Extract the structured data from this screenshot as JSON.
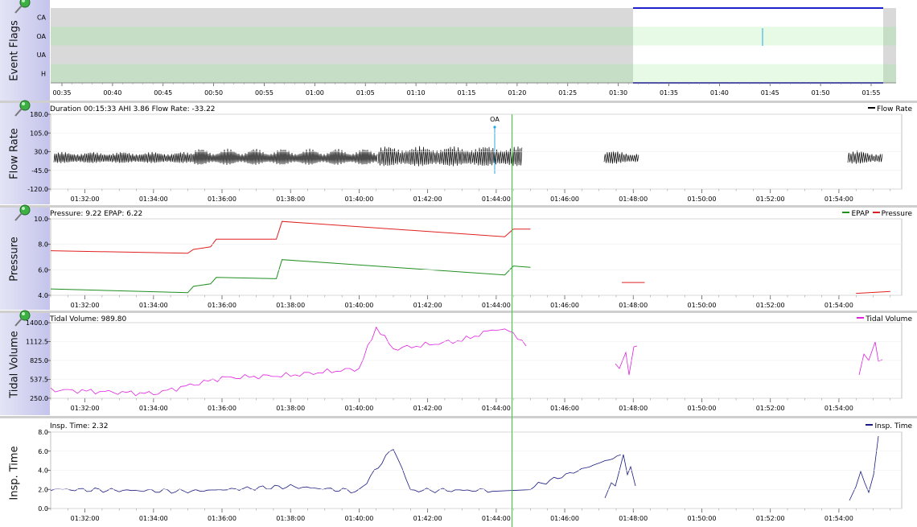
{
  "event_flags": {
    "label": "Event Flags",
    "rows": [
      "CA",
      "OA",
      "UA",
      "H"
    ],
    "xticks": [
      "00:35",
      "00:40",
      "00:45",
      "00:50",
      "00:55",
      "01:00",
      "01:05",
      "01:10",
      "01:15",
      "01:20",
      "01:25",
      "01:30",
      "01:35",
      "01:40",
      "01:45",
      "01:50",
      "01:55"
    ],
    "events": [
      {
        "type": "OA",
        "time": "01:44"
      }
    ],
    "selected_range": [
      "01:31",
      "01:56"
    ]
  },
  "xticks": [
    "01:32:00",
    "01:34:00",
    "01:36:00",
    "01:38:00",
    "01:40:00",
    "01:42:00",
    "01:44:00",
    "01:46:00",
    "01:48:00",
    "01:50:00",
    "01:52:00",
    "01:54:00"
  ],
  "flow_rate": {
    "label": "Flow Rate",
    "info": "Duration 00:15:33 AHI 3.86 Flow Rate: -33.22",
    "legend": "Flow Rate",
    "event_label": "OA",
    "yticks": [
      "180.0",
      "105.0",
      "30.0",
      "-45.0",
      "-120.0"
    ]
  },
  "pressure": {
    "label": "Pressure",
    "info": "Pressure: 9.22 EPAP: 6.22",
    "legend_a": "EPAP",
    "legend_b": "Pressure",
    "yticks": [
      "10.0",
      "8.0",
      "6.0",
      "4.0"
    ]
  },
  "tidal_volume": {
    "label": "Tidal Volume",
    "info": "Tidal Volume: 989.80",
    "legend": "Tidal Volume",
    "yticks": [
      "1400.0",
      "1112.5",
      "825.0",
      "537.5",
      "250.0"
    ]
  },
  "insp_time": {
    "label": "Insp. Time",
    "info": "Insp. Time: 2.32",
    "legend": "Insp. Time",
    "yticks": [
      "8.0",
      "6.0",
      "4.0",
      "2.0",
      "0.0"
    ]
  },
  "colors": {
    "flow": "#000000",
    "pressure": "#e02020",
    "epap": "#1f8f1f",
    "tidal": "#e020e0",
    "insp": "#1a1a80",
    "cursor": "#33cc33",
    "event_oa": "#29a8e0"
  },
  "chart_data": [
    {
      "type": "line",
      "title": "Pressure",
      "x": [
        "01:31:00",
        "01:35:00",
        "01:35:10",
        "01:35:40",
        "01:35:50",
        "01:37:35",
        "01:37:45",
        "01:44:15",
        "01:44:30",
        "01:45:00",
        "01:47:40",
        "01:48:20",
        "01:54:30",
        "01:55:30"
      ],
      "series": [
        {
          "name": "Pressure",
          "values": [
            7.5,
            7.3,
            7.6,
            7.8,
            8.4,
            8.4,
            9.8,
            8.6,
            9.2,
            9.2,
            null,
            null,
            null,
            null
          ]
        },
        {
          "name": "EPAP",
          "values": [
            4.5,
            4.2,
            4.7,
            4.9,
            5.4,
            5.3,
            6.8,
            5.6,
            6.3,
            6.2,
            null,
            null,
            null,
            null
          ]
        }
      ],
      "ylim": [
        4,
        10
      ]
    },
    {
      "type": "line",
      "title": "Tidal Volume",
      "x": [
        "01:31:00",
        "01:34:00",
        "01:36:00",
        "01:38:00",
        "01:40:00",
        "01:40:30",
        "01:41:00",
        "01:43:00",
        "01:44:00",
        "01:44:30",
        "01:45:00"
      ],
      "series": [
        {
          "name": "Tidal Volume",
          "values": [
            380,
            320,
            560,
            600,
            700,
            1330,
            1000,
            1130,
            1310,
            1250,
            970
          ]
        }
      ],
      "ylim": [
        250,
        1400
      ]
    },
    {
      "type": "line",
      "title": "Insp. Time",
      "x": [
        "01:31:00",
        "01:35:00",
        "01:38:00",
        "01:40:00",
        "01:41:00",
        "01:41:30",
        "01:44:00",
        "01:45:00",
        "01:47:45",
        "01:48:15",
        "01:55:30"
      ],
      "series": [
        {
          "name": "Insp. Time",
          "values": [
            2.0,
            1.8,
            2.3,
            1.8,
            6.4,
            1.9,
            1.9,
            2.2,
            5.7,
            2.4,
            7.8
          ]
        }
      ],
      "ylim": [
        0,
        8
      ]
    }
  ]
}
